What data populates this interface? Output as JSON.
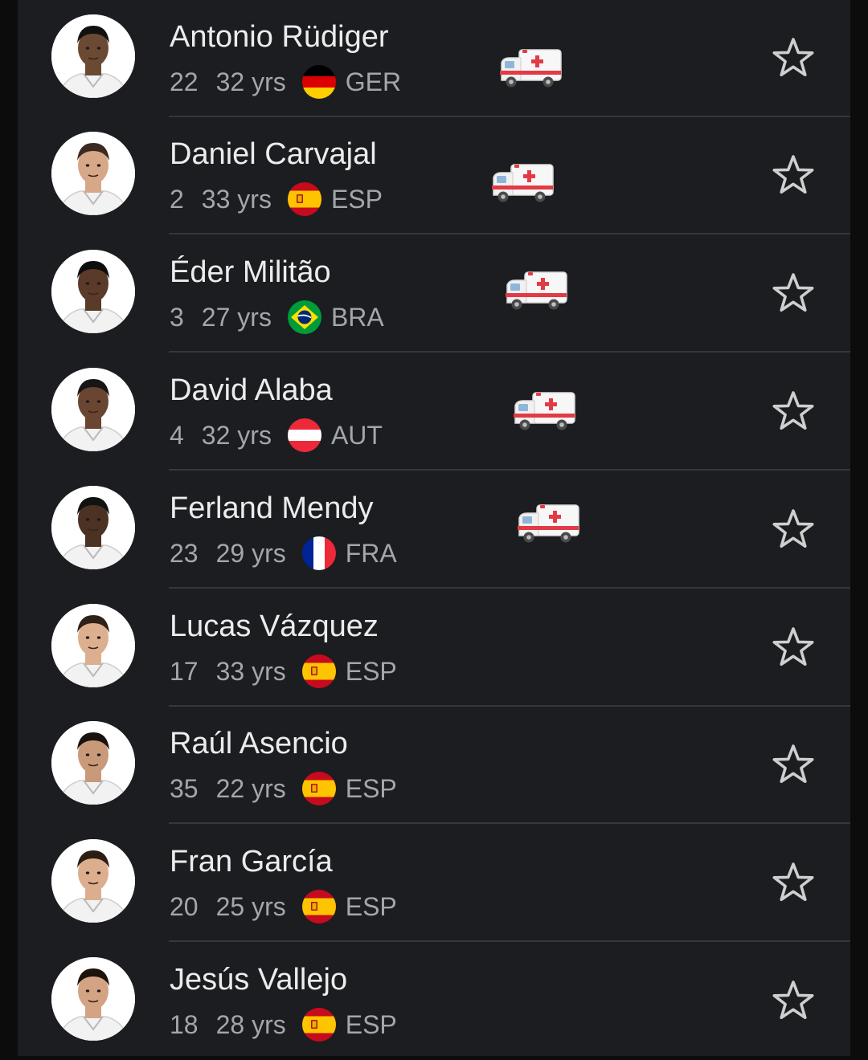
{
  "players": [
    {
      "name": "Antonio Rüdiger",
      "number": "22",
      "age": "32 yrs",
      "country": "GER",
      "flag": "de",
      "injured": true,
      "skin": "#6b4a33",
      "hair": "#111111"
    },
    {
      "name": "Daniel Carvajal",
      "number": "2",
      "age": "33 yrs",
      "country": "ESP",
      "flag": "es",
      "injured": true,
      "skin": "#d6a888",
      "hair": "#3b2a20"
    },
    {
      "name": "Éder Militão",
      "number": "3",
      "age": "27 yrs",
      "country": "BRA",
      "flag": "br",
      "injured": true,
      "skin": "#5a3a28",
      "hair": "#0e0e0e"
    },
    {
      "name": "David Alaba",
      "number": "4",
      "age": "32 yrs",
      "country": "AUT",
      "flag": "at",
      "injured": true,
      "skin": "#6a4632",
      "hair": "#161616"
    },
    {
      "name": "Ferland Mendy",
      "number": "23",
      "age": "29 yrs",
      "country": "FRA",
      "flag": "fr",
      "injured": true,
      "skin": "#4b3223",
      "hair": "#121212"
    },
    {
      "name": "Lucas Vázquez",
      "number": "17",
      "age": "33 yrs",
      "country": "ESP",
      "flag": "es",
      "injured": false,
      "skin": "#dcb08f",
      "hair": "#2e2118"
    },
    {
      "name": "Raúl Asencio",
      "number": "35",
      "age": "22 yrs",
      "country": "ESP",
      "flag": "es",
      "injured": false,
      "skin": "#c99a7a",
      "hair": "#1a120d"
    },
    {
      "name": "Fran García",
      "number": "20",
      "age": "25 yrs",
      "country": "ESP",
      "flag": "es",
      "injured": false,
      "skin": "#dcae8e",
      "hair": "#2b1d14"
    },
    {
      "name": "Jesús Vallejo",
      "number": "18",
      "age": "28 yrs",
      "country": "ESP",
      "flag": "es",
      "injured": false,
      "skin": "#d3a384",
      "hair": "#1c130d"
    }
  ],
  "icons": {
    "injury": "ambulance-icon",
    "favorite": "star-outline-icon"
  },
  "colors": {
    "background": "#1b1d20",
    "divider": "#34373c",
    "name": "#ececec",
    "meta": "#a3a6ab",
    "star": "#cfcfcf"
  }
}
